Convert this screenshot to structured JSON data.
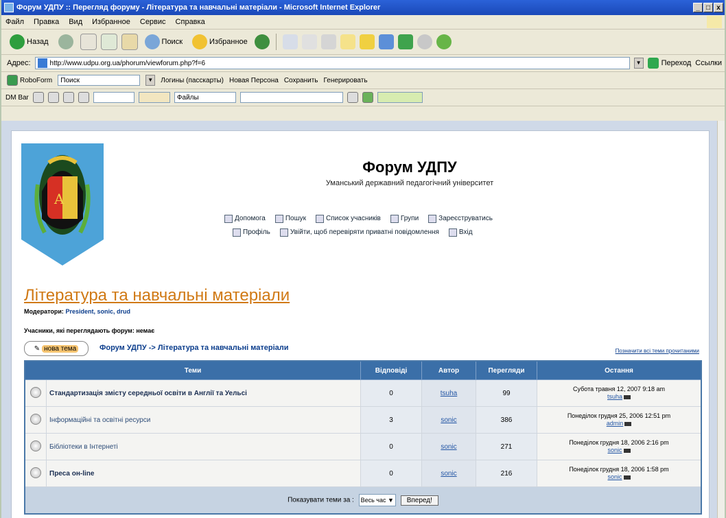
{
  "window": {
    "title": "Форум УДПУ :: Перегляд форуму - Література та навчальні матеріали - Microsoft Internet Explorer",
    "buttons": [
      "_",
      "□",
      "x"
    ]
  },
  "menu": [
    "Файл",
    "Правка",
    "Вид",
    "Избранное",
    "Сервис",
    "Справка"
  ],
  "toolbar": {
    "back": "Назад",
    "search": "Поиск",
    "favorites": "Избранное"
  },
  "address": {
    "label": "Адрес:",
    "url": "http://www.udpu.org.ua/phorum/viewforum.php?f=6",
    "go": "Переход",
    "links": "Ссылки"
  },
  "linksbar": {
    "roboform": "RoboForm",
    "search_field": "Поиск",
    "logins": "Логины",
    "passcards": "(пасскарты)",
    "new_person": "Новая Персона",
    "save": "Сохранить",
    "generate": "Генерировать"
  },
  "dmbar": {
    "label": "DM Bar",
    "files": "Файлы"
  },
  "site": {
    "title": "Форум УДПУ",
    "subtitle": "Уманський державний педагогічний університет",
    "nav_row1": [
      "Допомога",
      "Пошук",
      "Список учасників",
      "Групи",
      "Зареєструватись"
    ],
    "nav_row2": [
      "Профіль",
      "Увійти, щоб перевіряти приватні повідомлення",
      "Вхід"
    ]
  },
  "forum": {
    "title": "Література та навчальні матеріали",
    "moderators_label": "Модератори:",
    "moderators": "President, sonic, drud",
    "readers": "Учасники, які переглядають форум: немає",
    "new_topic": "нова тема",
    "breadcrumb": "Форум УДПУ -> Література та навчальні матеріали",
    "mark_read": "Позначити всі теми прочитаними"
  },
  "table": {
    "headers": [
      "Теми",
      "Відповіді",
      "Автор",
      "Перегляди",
      "Остання"
    ],
    "rows": [
      {
        "topic": "Стандартизація змісту середньої освіти в Англії та Уельсі",
        "replies": "0",
        "author": "tsuha",
        "views": "99",
        "last_date": "Субота травня 12, 2007 9:18 am",
        "last_user": "tsuha",
        "bold": true
      },
      {
        "topic": "Інформаційні та освітні ресурси",
        "replies": "3",
        "author": "sonic",
        "views": "386",
        "last_date": "Понеділок грудня 25, 2006 12:51 pm",
        "last_user": "admin",
        "bold": false
      },
      {
        "topic": "Бібліотеки в Інтернеті",
        "replies": "0",
        "author": "sonic",
        "views": "271",
        "last_date": "Понеділок грудня 18, 2006 2:16 pm",
        "last_user": "sonic",
        "bold": false
      },
      {
        "topic": "Преса он-line",
        "replies": "0",
        "author": "sonic",
        "views": "216",
        "last_date": "Понеділок грудня 18, 2006 1:58 pm",
        "last_user": "sonic",
        "bold": true
      }
    ],
    "footer_label": "Показувати теми за :",
    "footer_select": "Весь час",
    "footer_go": "Вперед!"
  },
  "colors": {
    "forum_title": "#d07914",
    "header_bg": "#3b6fa8",
    "link": "#0b3d8c"
  }
}
